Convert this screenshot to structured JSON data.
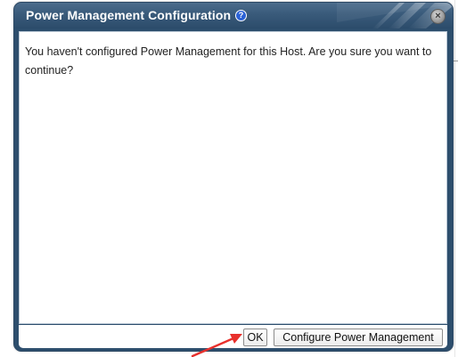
{
  "dialog": {
    "title": "Power Management Configuration",
    "help_icon": "help-icon",
    "help_glyph": "?",
    "close_icon": "close-icon",
    "close_glyph": "×",
    "message": "You haven't configured Power Management for this Host. Are you sure you want to continue?",
    "buttons": {
      "ok_label": "OK",
      "configure_label": "Configure Power Management"
    }
  },
  "annotation": {
    "arrow_icon": "red-arrow-icon",
    "arrow_color": "#e8302c"
  },
  "colors": {
    "titlebar": "#395a7a",
    "frame": "#2d4e6d",
    "help_icon_bg": "#2b62d6"
  }
}
